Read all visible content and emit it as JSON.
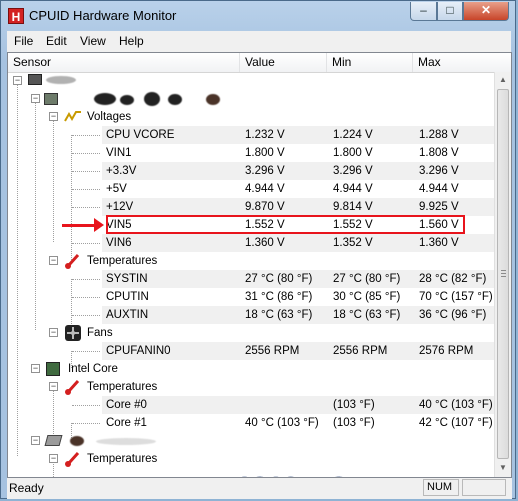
{
  "window": {
    "title": "CPUID Hardware Monitor",
    "app_icon_letter": "H",
    "minimize_glyph": "–",
    "maximize_glyph": "□",
    "close_glyph": "✕"
  },
  "menu": [
    "File",
    "Edit",
    "View",
    "Help"
  ],
  "columns": [
    "Sensor",
    "Value",
    "Min",
    "Max"
  ],
  "tree": {
    "expander_minus": "−",
    "voltages_label": "Voltages",
    "temperatures_label": "Temperatures",
    "fans_label": "Fans",
    "cpu_label": "Intel Core",
    "cpu_temps_label": "Temperatures",
    "drive_temps_label": "Temperatures"
  },
  "voltages": [
    {
      "name": "CPU VCORE",
      "value": "1.232 V",
      "min": "1.224 V",
      "max": "1.288 V"
    },
    {
      "name": "VIN1",
      "value": "1.800 V",
      "min": "1.800 V",
      "max": "1.808 V"
    },
    {
      "name": "+3.3V",
      "value": "3.296 V",
      "min": "3.296 V",
      "max": "3.296 V"
    },
    {
      "name": "+5V",
      "value": "4.944 V",
      "min": "4.944 V",
      "max": "4.944 V"
    },
    {
      "name": "+12V",
      "value": "9.870 V",
      "min": "9.814 V",
      "max": "9.925 V"
    },
    {
      "name": "VIN5",
      "value": "1.552 V",
      "min": "1.552 V",
      "max": "1.560 V"
    },
    {
      "name": "VIN6",
      "value": "1.360 V",
      "min": "1.352 V",
      "max": "1.360 V"
    }
  ],
  "temperatures": [
    {
      "name": "SYSTIN",
      "value": "27 °C  (80 °F)",
      "min": "27 °C  (80 °F)",
      "max": "28 °C  (82 °F)"
    },
    {
      "name": "CPUTIN",
      "value": "31 °C  (86 °F)",
      "min": "30 °C  (85 °F)",
      "max": "70 °C  (157 °F)"
    },
    {
      "name": "AUXTIN",
      "value": "18 °C  (63 °F)",
      "min": "18 °C  (63 °F)",
      "max": "36 °C  (96 °F)"
    }
  ],
  "fans": [
    {
      "name": "CPUFANIN0",
      "value": "2556 RPM",
      "min": "2556 RPM",
      "max": "2576 RPM"
    }
  ],
  "cpu_temps": [
    {
      "name": "Core #0",
      "value": "",
      "min": "(103 °F)",
      "max": "40 °C  (103 °F)"
    },
    {
      "name": "Core #1",
      "value": "40 °C  (103 °F)",
      "min": "(103 °F)",
      "max": "42 °C  (107 °F)"
    }
  ],
  "watermark": "pcnexus",
  "status": {
    "text": "Ready",
    "num": "NUM"
  },
  "colors": {
    "highlight": "#e8141c",
    "watermark": "#29c1d6"
  }
}
